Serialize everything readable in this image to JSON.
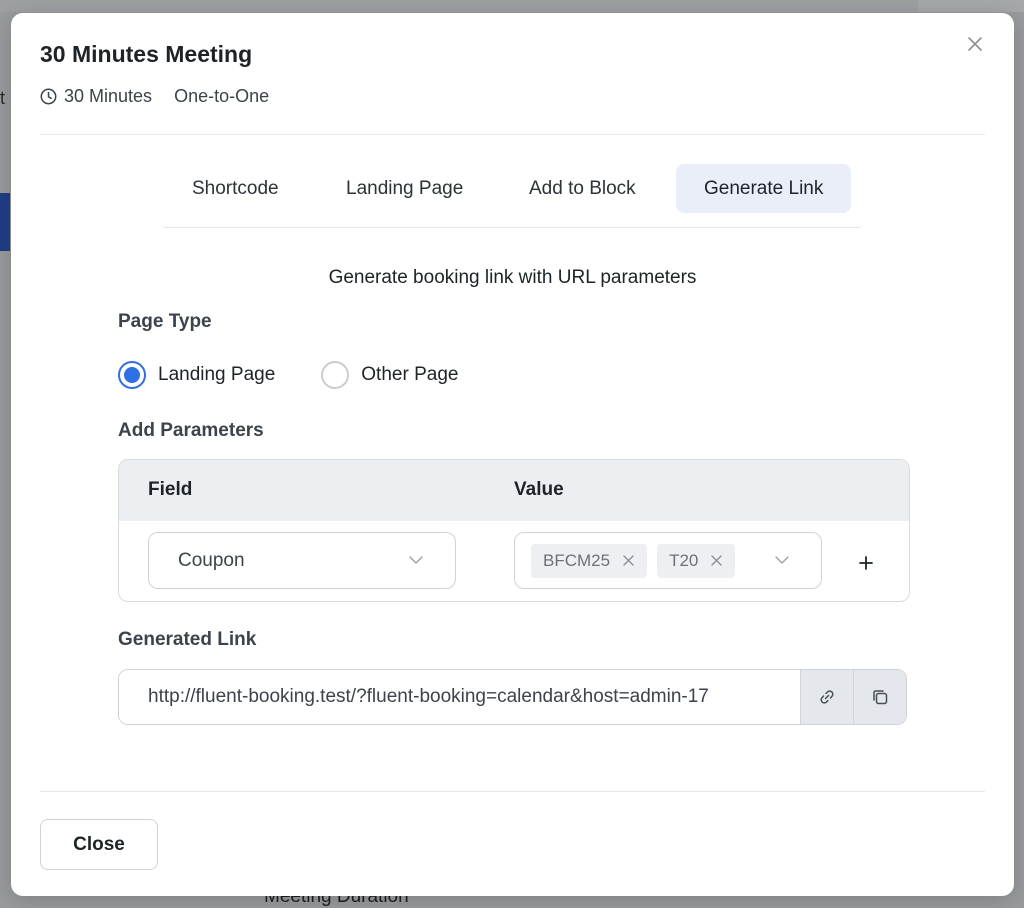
{
  "background": {
    "edge_text": "t",
    "field_label": "Meeting Duration *"
  },
  "modal": {
    "title": "30 Minutes Meeting",
    "meta": {
      "duration": "30 Minutes",
      "type": "One-to-One",
      "clock_icon": "clock-icon"
    },
    "close_icon": "close-icon",
    "tabs": [
      {
        "label": "Shortcode",
        "active": false
      },
      {
        "label": "Landing Page",
        "active": false
      },
      {
        "label": "Add to Block",
        "active": false
      },
      {
        "label": "Generate Link",
        "active": true
      }
    ],
    "subtitle": "Generate booking link with URL parameters",
    "page_type": {
      "label": "Page Type",
      "options": [
        {
          "label": "Landing Page",
          "checked": true
        },
        {
          "label": "Other Page",
          "checked": false
        }
      ]
    },
    "parameters": {
      "label": "Add Parameters",
      "headers": {
        "field": "Field",
        "value": "Value"
      },
      "rows": [
        {
          "field": "Coupon",
          "values": [
            "BFCM25",
            "T20"
          ]
        }
      ],
      "add_icon": "plus-icon"
    },
    "generated_link": {
      "label": "Generated Link",
      "value": "http://fluent-booking.test/?fluent-booking=calendar&host=admin-17",
      "link_icon": "link-icon",
      "copy_icon": "copy-icon"
    },
    "footer": {
      "close_label": "Close"
    }
  },
  "colors": {
    "accent": "#2f6fe4",
    "active_tab_bg": "#e9eef9",
    "overlay": "#9a9b9e"
  }
}
